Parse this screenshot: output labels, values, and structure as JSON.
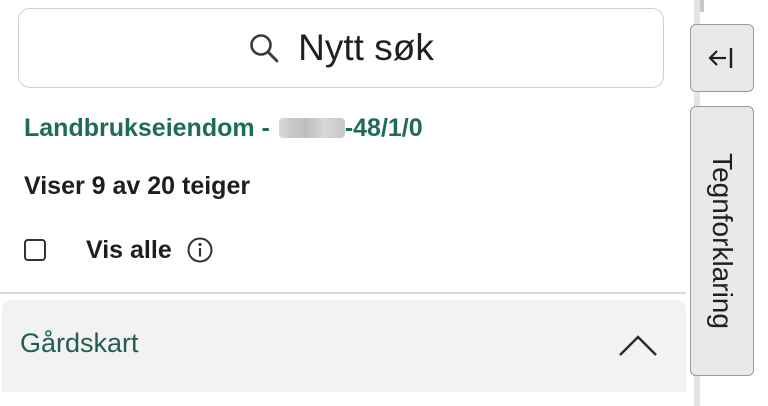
{
  "search": {
    "label": "Nytt søk",
    "icon": "search-icon"
  },
  "property": {
    "prefix": "Landbrukseiendom - ",
    "suffix": "-48/1/0"
  },
  "parcels": {
    "summary": "Viser 9 av 20 teiger"
  },
  "show_all": {
    "label": "Vis alle",
    "checked": false,
    "info_icon": "info-icon"
  },
  "accordion": {
    "title": "Gårdskart",
    "expanded": true,
    "icon": "chevron-up-icon"
  },
  "side": {
    "collapse_icon": "collapse-left-icon",
    "legend_label": "Tegnforklaring"
  },
  "colors": {
    "accent": "#1f6b5b",
    "accent_dark": "#1f5d50",
    "tab_bg": "#e9e9e9"
  }
}
